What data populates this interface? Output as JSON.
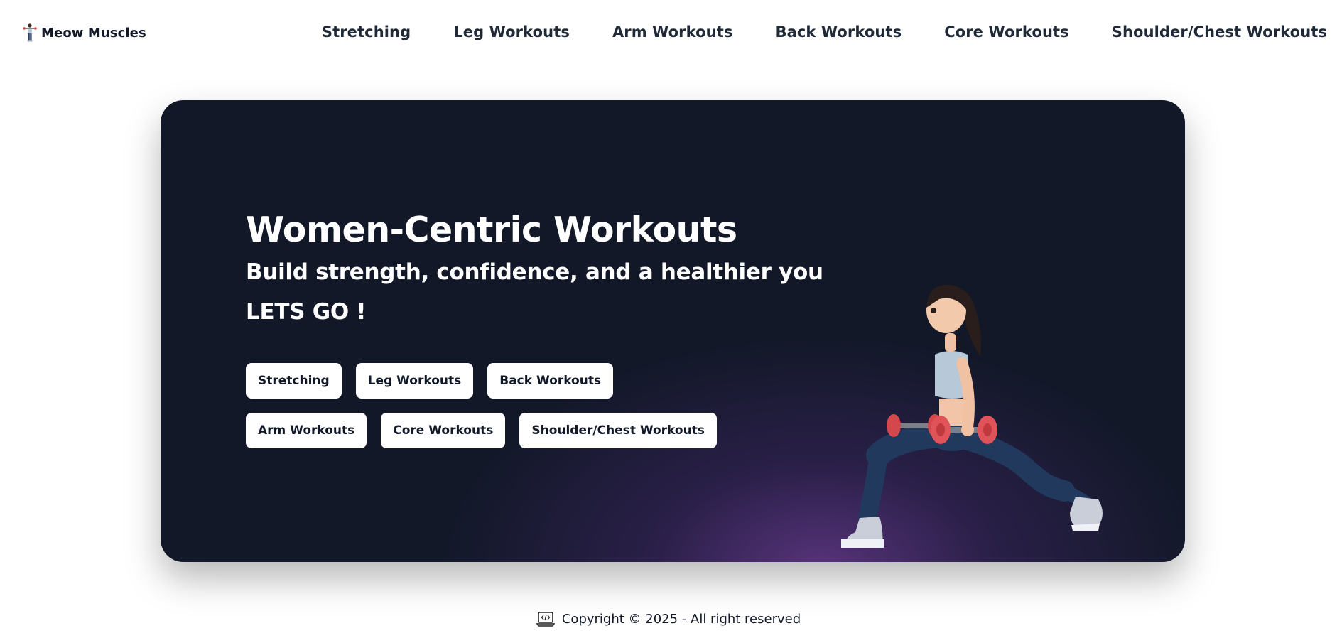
{
  "brand": {
    "name": "Meow Muscles",
    "logo_icon": "woman-lifting-weights-icon"
  },
  "nav": {
    "items": [
      {
        "label": "Stretching"
      },
      {
        "label": "Leg Workouts"
      },
      {
        "label": "Arm Workouts"
      },
      {
        "label": "Back Workouts"
      },
      {
        "label": "Core Workouts"
      },
      {
        "label": "Shoulder/Chest Workouts"
      }
    ]
  },
  "hero": {
    "title": "Women-Centric Workouts",
    "subtitle": "Build strength, confidence, and a healthier you",
    "cta": "LETS GO !",
    "buttons": [
      {
        "label": "Stretching"
      },
      {
        "label": "Leg Workouts"
      },
      {
        "label": "Back Workouts"
      },
      {
        "label": "Arm Workouts"
      },
      {
        "label": "Core Workouts"
      },
      {
        "label": "Shoulder/Chest Workouts"
      }
    ],
    "illustration": "woman-lunge-with-dumbbells-illustration"
  },
  "footer": {
    "icon": "laptop-code-icon",
    "text": "Copyright © 2025 - All right reserved"
  },
  "colors": {
    "hero_background": "#121828",
    "hero_glow": "#6e3c96",
    "button_background": "#ffffff",
    "text_dark": "#111827"
  }
}
